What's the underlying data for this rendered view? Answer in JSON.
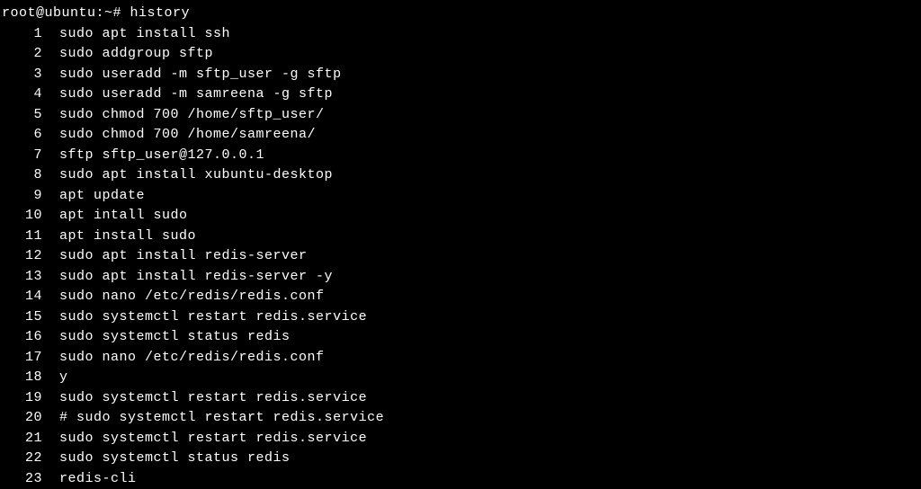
{
  "prompt": "root@ubuntu:~# history",
  "history": [
    {
      "n": "1",
      "cmd": "sudo apt install ssh"
    },
    {
      "n": "2",
      "cmd": "sudo addgroup sftp"
    },
    {
      "n": "3",
      "cmd": "sudo useradd -m sftp_user -g sftp"
    },
    {
      "n": "4",
      "cmd": "sudo useradd -m samreena -g sftp"
    },
    {
      "n": "5",
      "cmd": "sudo chmod 700 /home/sftp_user/"
    },
    {
      "n": "6",
      "cmd": "sudo chmod 700 /home/samreena/"
    },
    {
      "n": "7",
      "cmd": "sftp sftp_user@127.0.0.1"
    },
    {
      "n": "8",
      "cmd": "sudo apt install xubuntu-desktop"
    },
    {
      "n": "9",
      "cmd": "apt update"
    },
    {
      "n": "10",
      "cmd": "apt intall sudo"
    },
    {
      "n": "11",
      "cmd": "apt install sudo"
    },
    {
      "n": "12",
      "cmd": "sudo apt install redis-server"
    },
    {
      "n": "13",
      "cmd": "sudo apt install redis-server -y"
    },
    {
      "n": "14",
      "cmd": "sudo nano /etc/redis/redis.conf"
    },
    {
      "n": "15",
      "cmd": "sudo systemctl restart redis.service"
    },
    {
      "n": "16",
      "cmd": "sudo systemctl status redis"
    },
    {
      "n": "17",
      "cmd": "sudo nano /etc/redis/redis.conf"
    },
    {
      "n": "18",
      "cmd": "y"
    },
    {
      "n": "19",
      "cmd": "sudo systemctl restart redis.service"
    },
    {
      "n": "20",
      "cmd": "# sudo systemctl restart redis.service"
    },
    {
      "n": "21",
      "cmd": "sudo systemctl restart redis.service"
    },
    {
      "n": "22",
      "cmd": "sudo systemctl status redis"
    },
    {
      "n": "23",
      "cmd": "redis-cli"
    }
  ]
}
